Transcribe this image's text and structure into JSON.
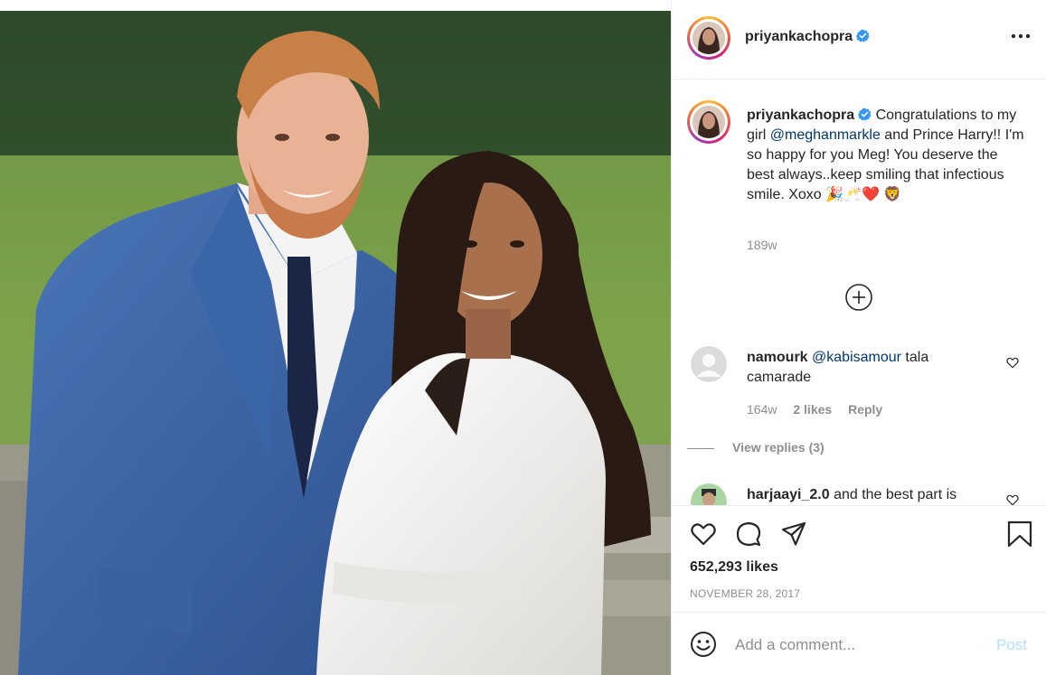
{
  "colors": {
    "accent_blue": "#0095f6",
    "verified_blue": "#3897f0",
    "post_disabled": "#b2dffc",
    "heart_red": "#ed4956",
    "secondary_text": "#8e8e8e",
    "link_text": "#00376b"
  },
  "header": {
    "username": "priyankachopra",
    "verified_icon": "verified-badge-icon",
    "more_icon": "more-horizontal-icon"
  },
  "caption": {
    "username": "priyankachopra",
    "text_before": " Congratulations to my girl ",
    "mention": "@meghanmarkle",
    "text_after": " and Prince Harry!! I'm so happy for you Meg! You deserve the best always..keep smiling that infectious smile. Xoxo 🎉🥂❤️ 🦁",
    "time": "189w"
  },
  "load_more_icon": "plus-circle-icon",
  "comments": [
    {
      "username": "namourk",
      "mention": "@kabisamour",
      "text": " tala camarade",
      "time": "164w",
      "likes": "2 likes",
      "reply": "Reply",
      "view_replies": "View replies (3)"
    },
    {
      "username": "harjaayi_2.0",
      "text": " and the best part is"
    }
  ],
  "actions": {
    "like_icon": "heart-icon",
    "comment_icon": "comment-icon",
    "share_icon": "paper-plane-icon",
    "save_icon": "bookmark-icon"
  },
  "likes_count": "652,293 likes",
  "post_date": "NOVEMBER 28, 2017",
  "add_comment": {
    "emoji_icon": "emoji-smile-icon",
    "placeholder": "Add a comment...",
    "post_label": "Post"
  }
}
